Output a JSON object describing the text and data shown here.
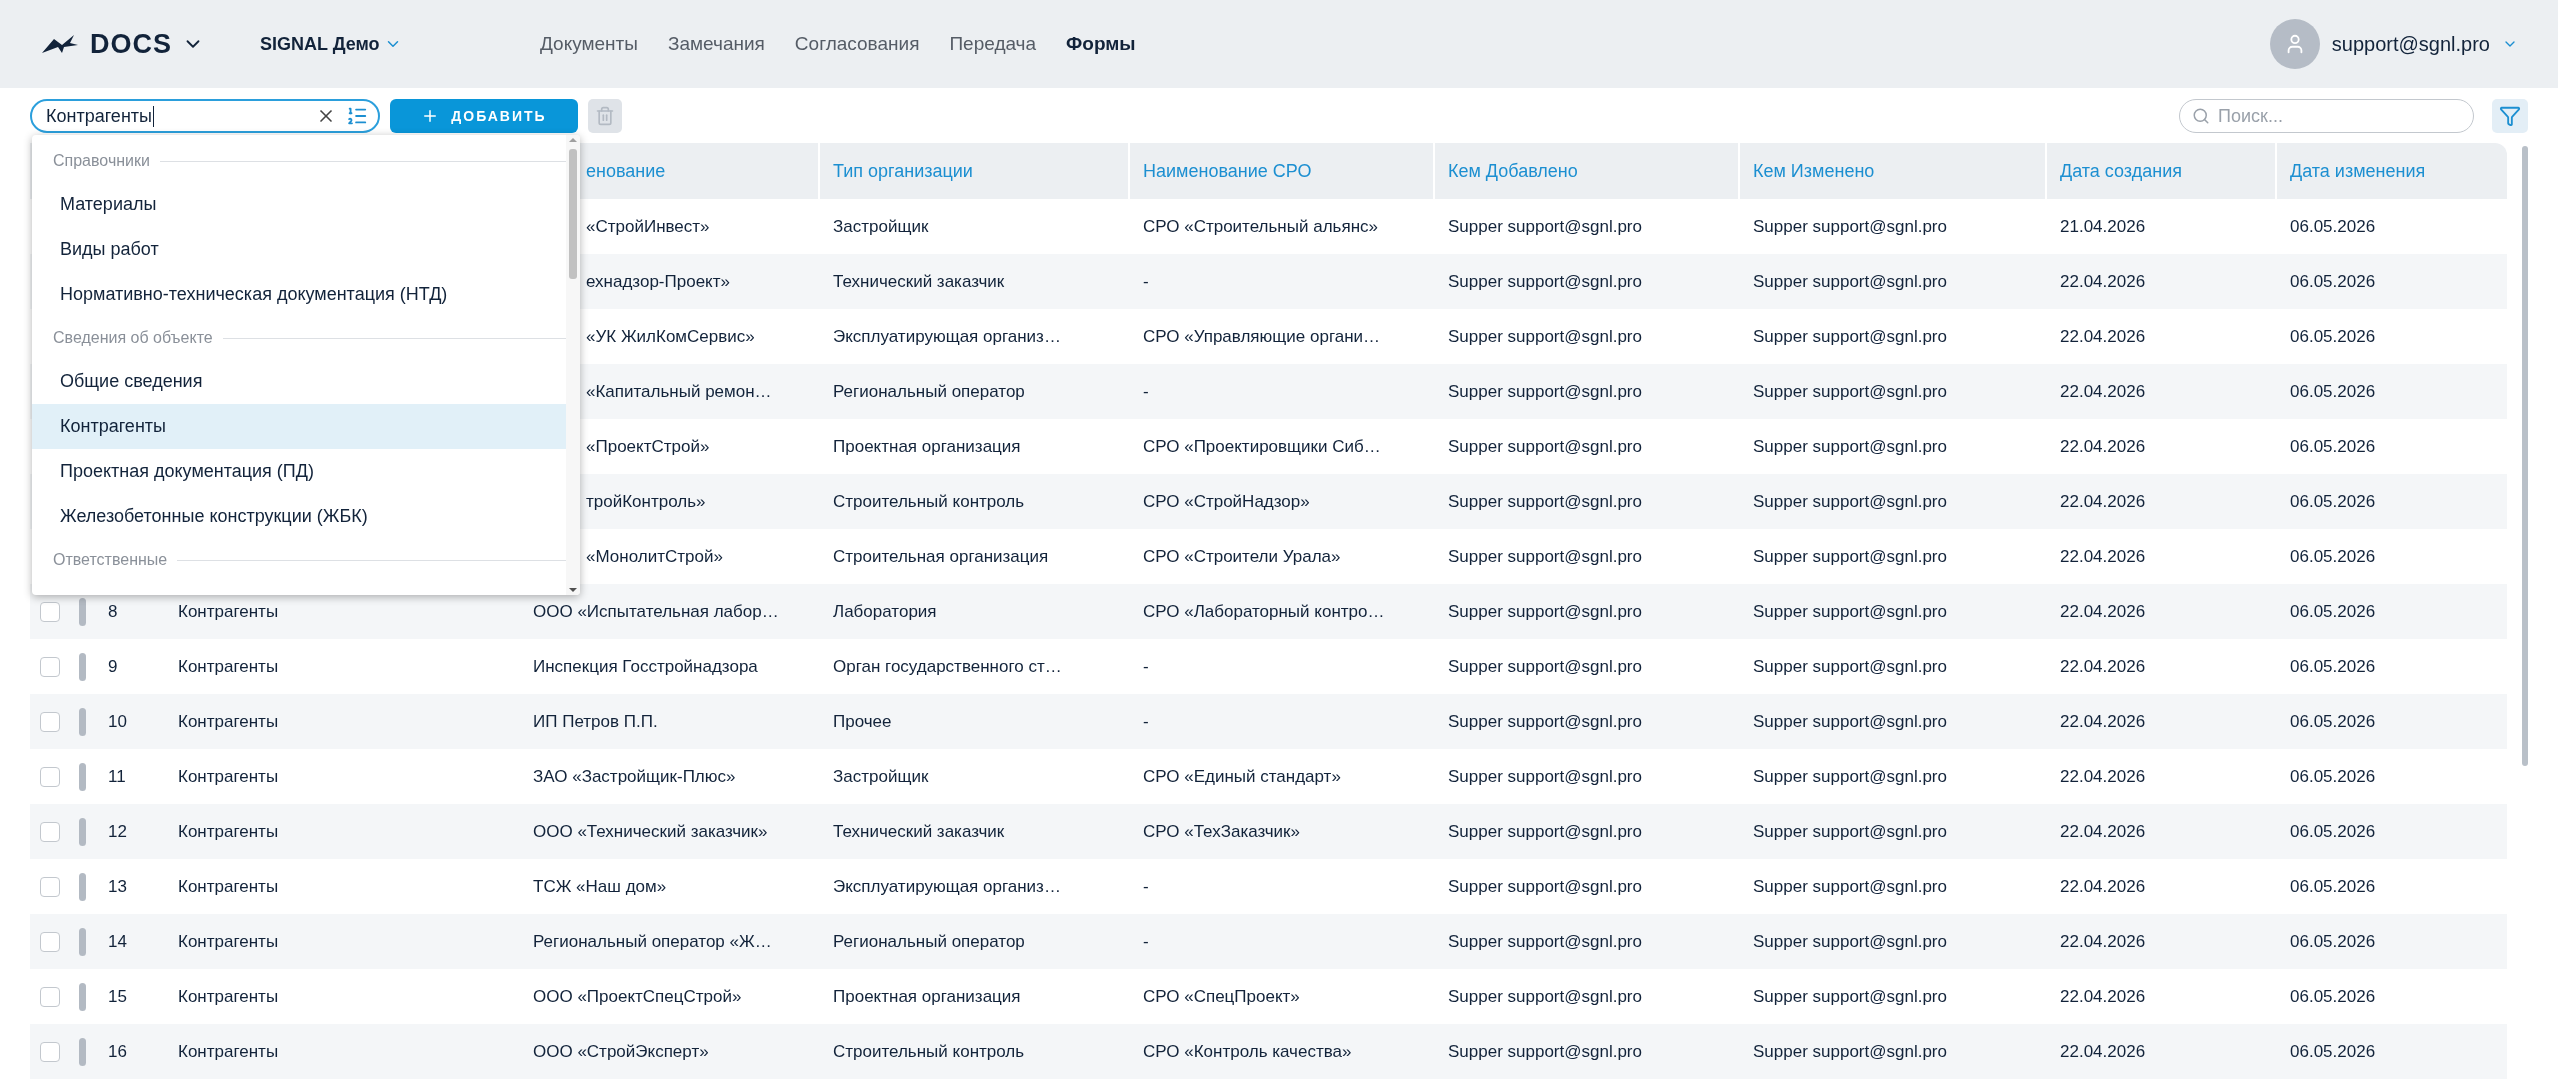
{
  "header": {
    "logo": "DOCS",
    "project": "SIGNAL Демо",
    "nav": [
      {
        "label": "Документы",
        "selected": false
      },
      {
        "label": "Замечания",
        "selected": false
      },
      {
        "label": "Согласования",
        "selected": false
      },
      {
        "label": "Передача",
        "selected": false
      },
      {
        "label": "Формы",
        "selected": true
      }
    ],
    "user": "support@sgnl.pro"
  },
  "toolbar": {
    "form_select": {
      "value": "Контрагенты"
    },
    "add_button": "ДОБАВИТЬ",
    "search": {
      "placeholder": "Поиск..."
    }
  },
  "dropdown": {
    "items": [
      {
        "kind": "group",
        "label": "Справочники"
      },
      {
        "kind": "option",
        "label": "Материалы",
        "selected": false
      },
      {
        "kind": "option",
        "label": "Виды работ",
        "selected": false
      },
      {
        "kind": "option",
        "label": "Нормативно-техническая документация (НТД)",
        "selected": false
      },
      {
        "kind": "group",
        "label": "Сведения об объекте"
      },
      {
        "kind": "option",
        "label": "Общие сведения",
        "selected": false
      },
      {
        "kind": "option",
        "label": "Контрагенты",
        "selected": true
      },
      {
        "kind": "option",
        "label": "Проектная документация (ПД)",
        "selected": false
      },
      {
        "kind": "option",
        "label": "Железобетонные конструкции (ЖБК)",
        "selected": false
      },
      {
        "kind": "group",
        "label": "Ответственные"
      }
    ]
  },
  "table": {
    "columns": [
      "енование",
      "Тип организации",
      "Наименование СРО",
      "Кем Добавлено",
      "Кем Изменено",
      "Дата создания",
      "Дата изменения"
    ],
    "rows": [
      {
        "name": "«СтройИнвест»",
        "org_type": "Застройщик",
        "sro": "СРО «Строительный альянс»",
        "added_by": "Supper support@sgnl.pro",
        "changed_by": "Supper support@sgnl.pro",
        "created": "21.04.2026",
        "modified": "06.05.2026"
      },
      {
        "name": "ехнадзор-Проект»",
        "org_type": "Технический заказчик",
        "sro": "-",
        "added_by": "Supper support@sgnl.pro",
        "changed_by": "Supper support@sgnl.pro",
        "created": "22.04.2026",
        "modified": "06.05.2026"
      },
      {
        "name": "«УК ЖилКомСервис»",
        "org_type": "Эксплуатирующая организ…",
        "sro": "СРО «Управляющие органи…",
        "added_by": "Supper support@sgnl.pro",
        "changed_by": "Supper support@sgnl.pro",
        "created": "22.04.2026",
        "modified": "06.05.2026"
      },
      {
        "name": "«Капитальный ремон…",
        "org_type": "Региональный оператор",
        "sro": "-",
        "added_by": "Supper support@sgnl.pro",
        "changed_by": "Supper support@sgnl.pro",
        "created": "22.04.2026",
        "modified": "06.05.2026"
      },
      {
        "name": "«ПроектСтрой»",
        "org_type": "Проектная организация",
        "sro": "СРО «Проектировщики Сиб…",
        "added_by": "Supper support@sgnl.pro",
        "changed_by": "Supper support@sgnl.pro",
        "created": "22.04.2026",
        "modified": "06.05.2026"
      },
      {
        "name": "тройКонтроль»",
        "org_type": "Строительный контроль",
        "sro": "СРО «СтройНадзор»",
        "added_by": "Supper support@sgnl.pro",
        "changed_by": "Supper support@sgnl.pro",
        "created": "22.04.2026",
        "modified": "06.05.2026"
      },
      {
        "name": "«МонолитСтрой»",
        "org_type": "Строительная организация",
        "sro": "СРО «Строители Урала»",
        "added_by": "Supper support@sgnl.pro",
        "changed_by": "Supper support@sgnl.pro",
        "created": "22.04.2026",
        "modified": "06.05.2026"
      },
      {
        "checked": false,
        "number": "8",
        "form": "Контрагенты",
        "name": "ООО «Испытательная лабор…",
        "org_type": "Лаборатория",
        "sro": "СРО «Лабораторный контро…",
        "added_by": "Supper support@sgnl.pro",
        "changed_by": "Supper support@sgnl.pro",
        "created": "22.04.2026",
        "modified": "06.05.2026"
      },
      {
        "checked": false,
        "number": "9",
        "form": "Контрагенты",
        "name": "Инспекция Госстройнадзора",
        "org_type": "Орган государственного ст…",
        "sro": "-",
        "added_by": "Supper support@sgnl.pro",
        "changed_by": "Supper support@sgnl.pro",
        "created": "22.04.2026",
        "modified": "06.05.2026"
      },
      {
        "checked": false,
        "number": "10",
        "form": "Контрагенты",
        "name": "ИП Петров П.П.",
        "org_type": "Прочее",
        "sro": "-",
        "added_by": "Supper support@sgnl.pro",
        "changed_by": "Supper support@sgnl.pro",
        "created": "22.04.2026",
        "modified": "06.05.2026"
      },
      {
        "checked": false,
        "number": "11",
        "form": "Контрагенты",
        "name": "ЗАО «Застройщик-Плюс»",
        "org_type": "Застройщик",
        "sro": "СРО «Единый стандарт»",
        "added_by": "Supper support@sgnl.pro",
        "changed_by": "Supper support@sgnl.pro",
        "created": "22.04.2026",
        "modified": "06.05.2026"
      },
      {
        "checked": false,
        "number": "12",
        "form": "Контрагенты",
        "name": "ООО «Технический заказчик»",
        "org_type": "Технический заказчик",
        "sro": "СРО «ТехЗаказчик»",
        "added_by": "Supper support@sgnl.pro",
        "changed_by": "Supper support@sgnl.pro",
        "created": "22.04.2026",
        "modified": "06.05.2026"
      },
      {
        "checked": false,
        "number": "13",
        "form": "Контрагенты",
        "name": "ТСЖ «Наш дом»",
        "org_type": "Эксплуатирующая организ…",
        "sro": "-",
        "added_by": "Supper support@sgnl.pro",
        "changed_by": "Supper support@sgnl.pro",
        "created": "22.04.2026",
        "modified": "06.05.2026"
      },
      {
        "checked": false,
        "number": "14",
        "form": "Контрагенты",
        "name": "Региональный оператор «Ж…",
        "org_type": "Региональный оператор",
        "sro": "-",
        "added_by": "Supper support@sgnl.pro",
        "changed_by": "Supper support@sgnl.pro",
        "created": "22.04.2026",
        "modified": "06.05.2026"
      },
      {
        "checked": false,
        "number": "15",
        "form": "Контрагенты",
        "name": "ООО «ПроектСпецСтрой»",
        "org_type": "Проектная организация",
        "sro": "СРО «СпецПроект»",
        "added_by": "Supper support@sgnl.pro",
        "changed_by": "Supper support@sgnl.pro",
        "created": "22.04.2026",
        "modified": "06.05.2026"
      },
      {
        "checked": false,
        "number": "16",
        "form": "Контрагенты",
        "name": "ООО «СтройЭксперт»",
        "org_type": "Строительный контроль",
        "sro": "СРО «Контроль качества»",
        "added_by": "Supper support@sgnl.pro",
        "changed_by": "Supper support@sgnl.pro",
        "created": "22.04.2026",
        "modified": "06.05.2026"
      }
    ]
  }
}
